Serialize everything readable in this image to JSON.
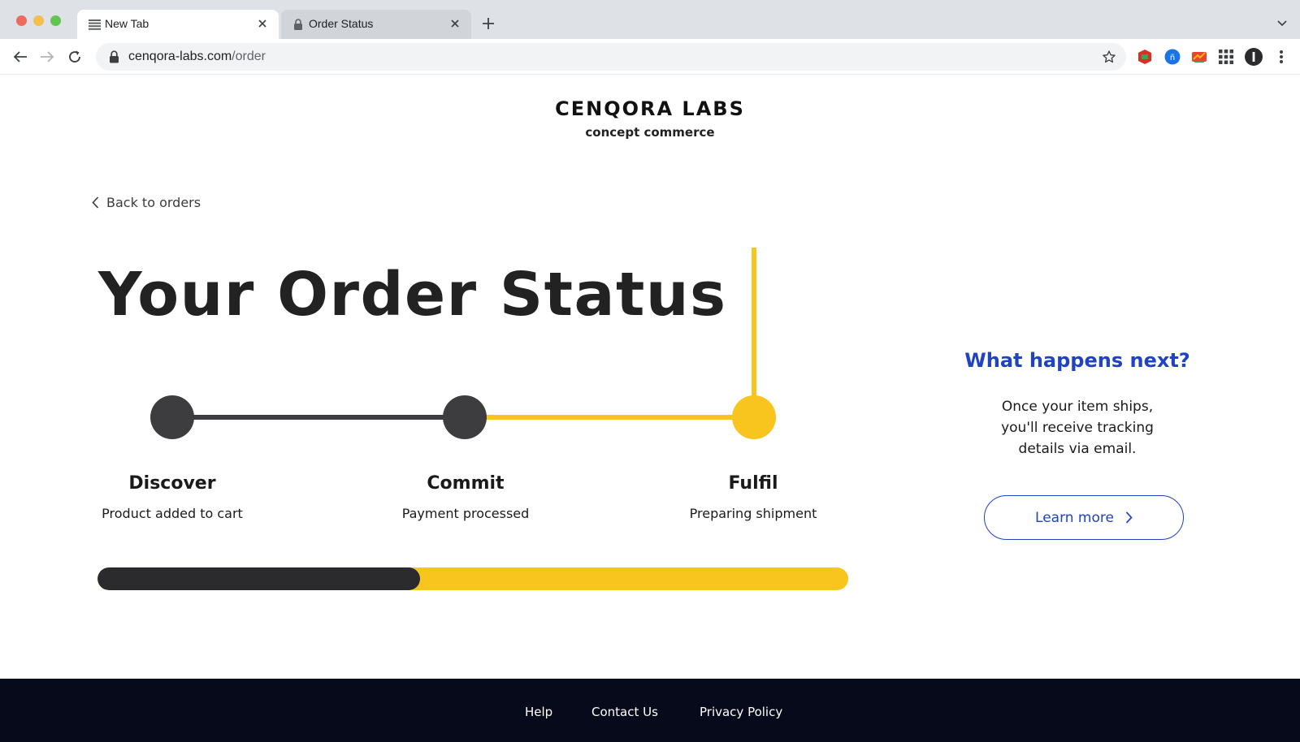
{
  "browser": {
    "tabs": [
      {
        "title": "New Tab",
        "active": true
      },
      {
        "title": "Order Status",
        "active": false
      }
    ],
    "url": {
      "host": "cenqora-labs.com",
      "path": "/order"
    },
    "icons": [
      "back-arrow-icon",
      "forward-arrow-icon",
      "reload-icon",
      "lock-icon",
      "star-icon",
      "extension-icons",
      "apps-grid-icon",
      "profile-icon",
      "menu-kebab-icon"
    ]
  },
  "brand": {
    "name": "CENQORA LABS",
    "tagline": "concept commerce"
  },
  "nav": {
    "back_label": "Back to orders"
  },
  "page": {
    "title": "Your Order Status"
  },
  "steps": [
    {
      "name": "Discover",
      "description": "Product added to cart",
      "state": "complete"
    },
    {
      "name": "Commit",
      "description": "Payment processed",
      "state": "complete"
    },
    {
      "name": "Fulfil",
      "description": "Preparing shipment",
      "state": "current"
    }
  ],
  "progress": {
    "complete_fraction": 0.43
  },
  "next": {
    "title": "What happens next?",
    "body": "Once your item ships, you'll receive tracking details via email.",
    "button_label": "Learn more"
  },
  "footer": {
    "links": [
      "Help",
      "Contact Us",
      "Privacy Policy"
    ]
  },
  "colors": {
    "accent_yellow": "#f7c51d",
    "dark": "#3d3d3f",
    "link_blue": "#1f43c4",
    "footer_bg": "#070a1a"
  }
}
